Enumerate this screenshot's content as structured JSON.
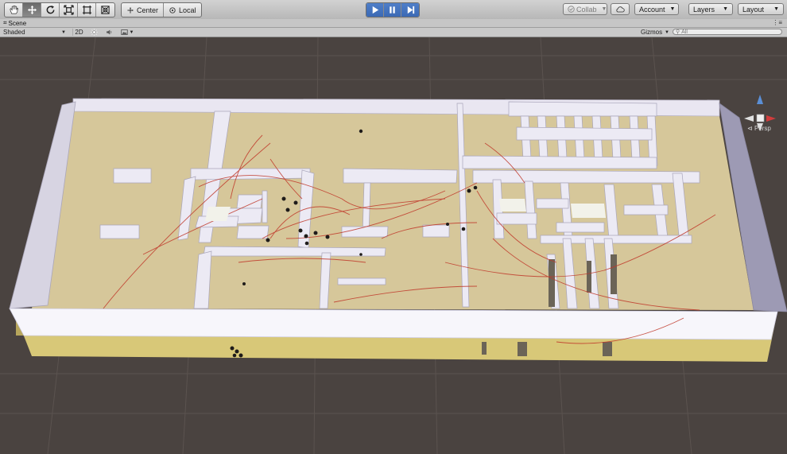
{
  "toolbar": {
    "tools": [
      {
        "name": "hand-tool-button",
        "icon": "hand-icon",
        "active": false
      },
      {
        "name": "move-tool-button",
        "icon": "move-icon",
        "active": true
      },
      {
        "name": "rotate-tool-button",
        "icon": "rotate-icon",
        "active": false
      },
      {
        "name": "scale-tool-button",
        "icon": "scale-icon",
        "active": false
      },
      {
        "name": "rect-tool-button",
        "icon": "rect-icon",
        "active": false
      },
      {
        "name": "transform-tool-button",
        "icon": "transform-icon",
        "active": false
      }
    ],
    "pivot_label": "Center",
    "space_label": "Local",
    "collab_label": "Collab",
    "account_label": "Account",
    "layers_label": "Layers",
    "layout_label": "Layout"
  },
  "scene_tab": {
    "label": "Scene"
  },
  "scene_bar": {
    "shading_mode": "Shaded",
    "mode_2d": "2D",
    "gizmos_label": "Gizmos",
    "search_placeholder": "All"
  },
  "orientation_gizmo": {
    "projection_label": "Persp"
  },
  "colors": {
    "toolbar_bg": "#c4c4c4",
    "play_active": "#3f6fbf",
    "scene_bg": "#4a4340",
    "floor": "#d6c79a",
    "walls": "#e6e3ee",
    "paths": "#c0392b"
  }
}
